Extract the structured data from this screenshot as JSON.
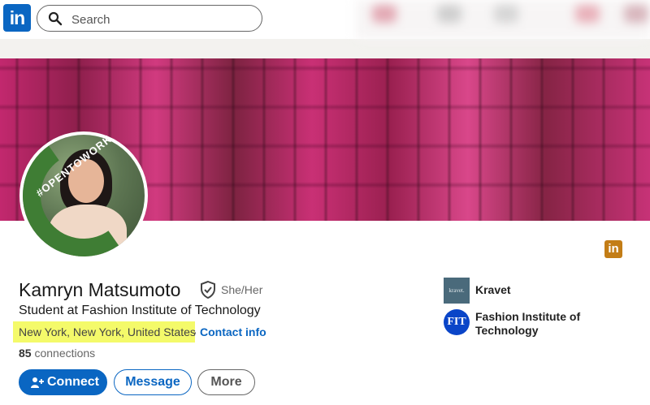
{
  "brand": {
    "logo_text": "in",
    "accent": "#0a66c2"
  },
  "search": {
    "placeholder": "Search",
    "icon": "search-icon"
  },
  "profile": {
    "name": "Kamryn Matsumoto",
    "pronouns": "She/Her",
    "headline": "Student at Fashion Institute of Technology",
    "location": "New York, New York, United States",
    "separator": "·",
    "contact_link": "Contact info",
    "connections_count": "85",
    "connections_label": "connections",
    "frame_badge": "#OPENTOWORK",
    "verify_icon": "verified-shield-icon"
  },
  "actions": {
    "connect": "Connect",
    "message": "Message",
    "more": "More"
  },
  "experience": [
    {
      "logo_text": "kravet.",
      "name": "Kravet"
    },
    {
      "logo_text": "FIT",
      "name": "Fashion Institute of Technology"
    }
  ],
  "badge": {
    "logo_text": "in",
    "color": "#c37d16"
  }
}
